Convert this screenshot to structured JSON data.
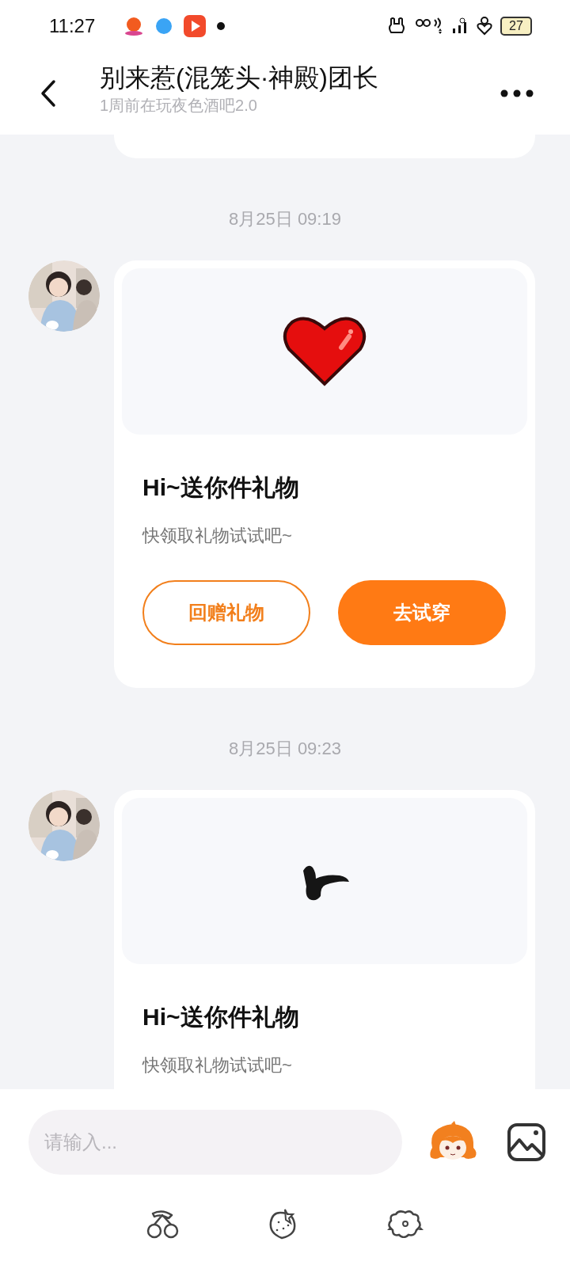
{
  "status_bar": {
    "time": "11:27",
    "battery": "27"
  },
  "header": {
    "title": "别来惹(混笼头·神殿)团长",
    "subtitle": "1周前在玩夜色酒吧2.0"
  },
  "messages": [
    {
      "timestamp": "8月25日 09:19",
      "kind": "heart",
      "title": "Hi~送你件礼物",
      "text": "快领取礼物试试吧~",
      "buttons": [
        {
          "label": "回赠礼物",
          "kind": "outline"
        },
        {
          "label": "去试穿",
          "kind": "filled"
        }
      ]
    },
    {
      "timestamp": "8月25日 09:23",
      "kind": "hair",
      "title": "Hi~送你件礼物",
      "text": "快领取礼物试试吧~"
    }
  ],
  "composer": {
    "placeholder": "请输入..."
  }
}
